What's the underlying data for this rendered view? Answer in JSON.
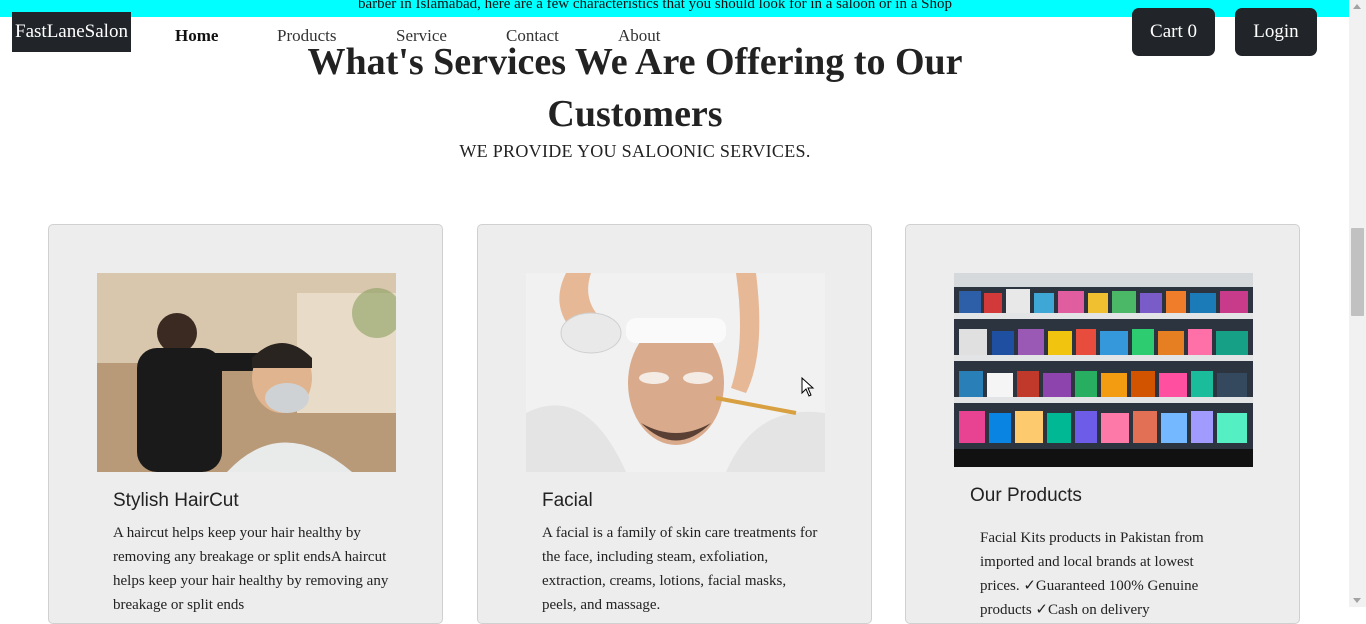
{
  "marquee": {
    "text": "barber in Islamabad, here are a few characteristics that you should look for in a saloon or in a Shop"
  },
  "nav": {
    "logo": "FastLaneSalon",
    "links": [
      "Home",
      "Products",
      "Service",
      "Contact",
      "About"
    ],
    "active": "Home",
    "cart_label": "Cart 0",
    "login_label": "Login"
  },
  "services": {
    "title_line1": "What's Services We Are Offering to Our",
    "title_line2": "Customers",
    "subtitle": "WE PROVIDE YOU SALOONIC SERVICES."
  },
  "cards": [
    {
      "title": "Stylish HairCut",
      "image": "barber-cutting-hair-photo",
      "text": "A haircut helps keep your hair healthy by removing any breakage or split endsA haircut helps keep your hair healthy by removing any breakage or split ends"
    },
    {
      "title": "Facial",
      "image": "facial-mask-treatment-photo",
      "text": "A facial is a family of skin care treatments for the face, including steam, exfoliation, extraction, creams, lotions, facial masks, peels, and massage."
    },
    {
      "title": "Our Products",
      "image": "cosmetics-store-shelves-photo",
      "text": "Facial Kits products in Pakistan from imported and local brands at lowest prices. ✓Guaranteed 100% Genuine products ✓Cash on delivery"
    }
  ],
  "colors": {
    "marquee_bg": "#00ffff",
    "dark_button": "#212529",
    "card_bg": "#ededed"
  }
}
